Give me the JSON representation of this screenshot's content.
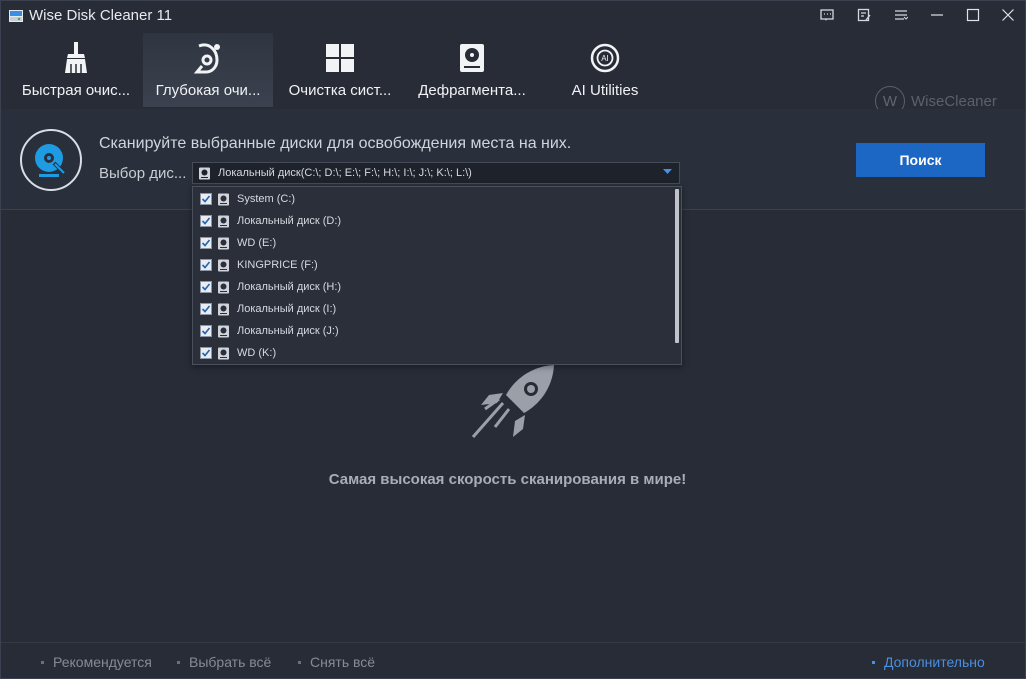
{
  "window": {
    "title": "Wise Disk Cleaner 11"
  },
  "title_controls": [
    "feedback-icon",
    "notes-icon",
    "menu-icon",
    "minimize-icon",
    "maximize-icon",
    "close-icon"
  ],
  "tabs": [
    {
      "label": "Быстрая очис...",
      "icon": "broom-icon",
      "active": false
    },
    {
      "label": "Глубокая очи...",
      "icon": "deep-clean-icon",
      "active": true
    },
    {
      "label": "Очистка сист...",
      "icon": "windows-icon",
      "active": false
    },
    {
      "label": "Дефрагмента...",
      "icon": "harddisk-icon",
      "active": false
    },
    {
      "label": "AI Utilities",
      "icon": "ai-icon",
      "active": false
    }
  ],
  "brand": {
    "logo_letter": "W",
    "text": "WiseCleaner"
  },
  "header": {
    "headline": "Сканируйте выбранные диски для освобождения места на них.",
    "select_label": "Выбор дис...",
    "select_value": "Локальный диск(C:\\; D:\\; E:\\; F:\\; H:\\; I:\\; J:\\; K:\\; L:\\)",
    "search_button": "Поиск"
  },
  "drives": [
    {
      "label": "System (C:)",
      "checked": true
    },
    {
      "label": "Локальный диск (D:)",
      "checked": true
    },
    {
      "label": "WD (E:)",
      "checked": true
    },
    {
      "label": "KINGPRICE (F:)",
      "checked": true
    },
    {
      "label": "Локальный диск (H:)",
      "checked": true
    },
    {
      "label": "Локальный диск (I:)",
      "checked": true
    },
    {
      "label": "Локальный диск (J:)",
      "checked": true
    },
    {
      "label": "WD (K:)",
      "checked": true
    }
  ],
  "main": {
    "tagline": "Самая высокая скорость сканирования в мире!"
  },
  "footer": {
    "recommended": "Рекомендуется",
    "select_all": "Выбрать всё",
    "deselect_all": "Снять всё",
    "more": "Дополнительно"
  },
  "colors": {
    "background": "#272c37",
    "accent": "#1c66c4",
    "link": "#4a8fe0"
  }
}
